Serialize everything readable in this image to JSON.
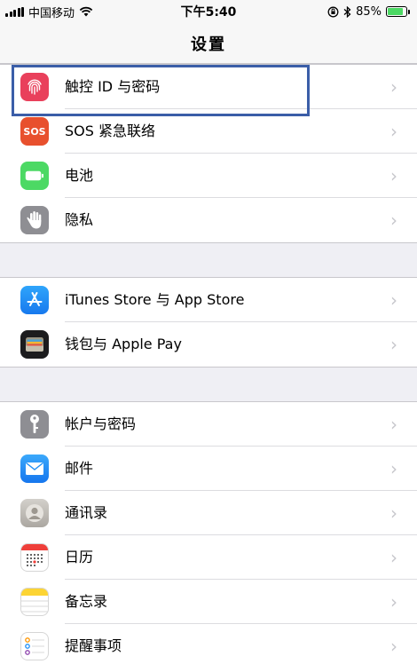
{
  "status_bar": {
    "carrier": "中国移动",
    "time": "下午5:40",
    "battery_percent": "85%",
    "battery_level": 0.85
  },
  "nav": {
    "title": "设置"
  },
  "groups": [
    {
      "rows": [
        {
          "label": "触控 ID 与密码",
          "icon": "fingerprint-icon",
          "color": "#e9405b"
        },
        {
          "label": "SOS 紧急联络",
          "icon": "sos-icon",
          "icon_text": "SOS",
          "color": "#e8502d"
        },
        {
          "label": "电池",
          "icon": "battery-icon",
          "color": "#4cd964"
        },
        {
          "label": "隐私",
          "icon": "hand-icon",
          "color": "#8e8e93"
        }
      ]
    },
    {
      "rows": [
        {
          "label": "iTunes Store 与 App Store",
          "icon": "app-store-icon",
          "color": "#1d8cf2"
        },
        {
          "label": "钱包与 Apple Pay",
          "icon": "wallet-icon",
          "color": "#1c1c1e"
        }
      ]
    },
    {
      "rows": [
        {
          "label": "帐户与密码",
          "icon": "key-icon",
          "color": "#8e8e93"
        },
        {
          "label": "邮件",
          "icon": "mail-icon",
          "color": "#1f8ff5"
        },
        {
          "label": "通讯录",
          "icon": "contacts-icon",
          "color": "#b5b2ad"
        },
        {
          "label": "日历",
          "icon": "calendar-icon",
          "color": "#ffffff"
        },
        {
          "label": "备忘录",
          "icon": "notes-icon",
          "color": "#ffffff"
        },
        {
          "label": "提醒事项",
          "icon": "reminders-icon",
          "color": "#ffffff"
        }
      ]
    }
  ]
}
